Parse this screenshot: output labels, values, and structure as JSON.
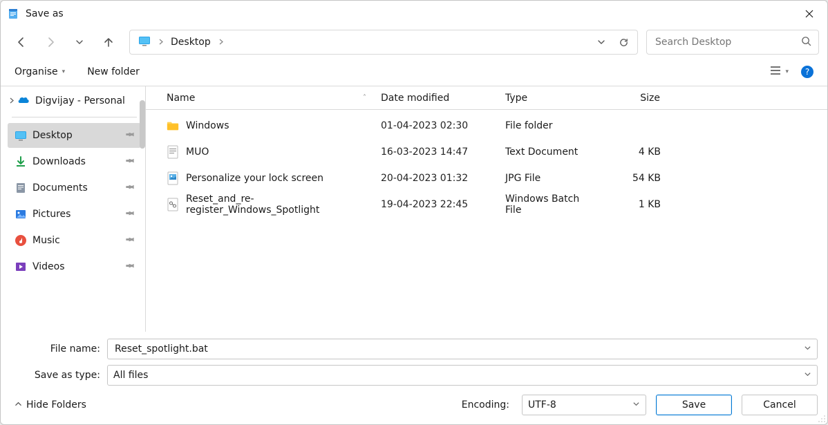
{
  "window": {
    "title": "Save as"
  },
  "nav": {
    "breadcrumb_location": "Desktop",
    "search_placeholder": "Search Desktop"
  },
  "toolbar": {
    "organise": "Organise",
    "new_folder": "New folder"
  },
  "sidebar": {
    "tree_root": "Digvijay - Personal",
    "items": [
      {
        "label": "Desktop",
        "icon": "desktop",
        "selected": true
      },
      {
        "label": "Downloads",
        "icon": "downloads",
        "selected": false
      },
      {
        "label": "Documents",
        "icon": "documents",
        "selected": false
      },
      {
        "label": "Pictures",
        "icon": "pictures",
        "selected": false
      },
      {
        "label": "Music",
        "icon": "music",
        "selected": false
      },
      {
        "label": "Videos",
        "icon": "videos",
        "selected": false
      }
    ]
  },
  "columns": {
    "name": "Name",
    "date": "Date modified",
    "type": "Type",
    "size": "Size"
  },
  "files": [
    {
      "name": "Windows",
      "date": "01-04-2023 02:30",
      "type": "File folder",
      "size": "",
      "icon": "folder"
    },
    {
      "name": "MUO",
      "date": "16-03-2023 14:47",
      "type": "Text Document",
      "size": "4 KB",
      "icon": "txt"
    },
    {
      "name": "Personalize your lock screen",
      "date": "20-04-2023 01:32",
      "type": "JPG File",
      "size": "54 KB",
      "icon": "jpg"
    },
    {
      "name": "Reset_and_re-register_Windows_Spotlight",
      "date": "19-04-2023 22:45",
      "type": "Windows Batch File",
      "size": "1 KB",
      "icon": "bat"
    }
  ],
  "form": {
    "filename_label": "File name:",
    "filename_value": "Reset_spotlight.bat",
    "type_label": "Save as type:",
    "type_value": "All files"
  },
  "footer": {
    "hide_folders": "Hide Folders",
    "encoding_label": "Encoding:",
    "encoding_value": "UTF-8",
    "save": "Save",
    "cancel": "Cancel"
  }
}
